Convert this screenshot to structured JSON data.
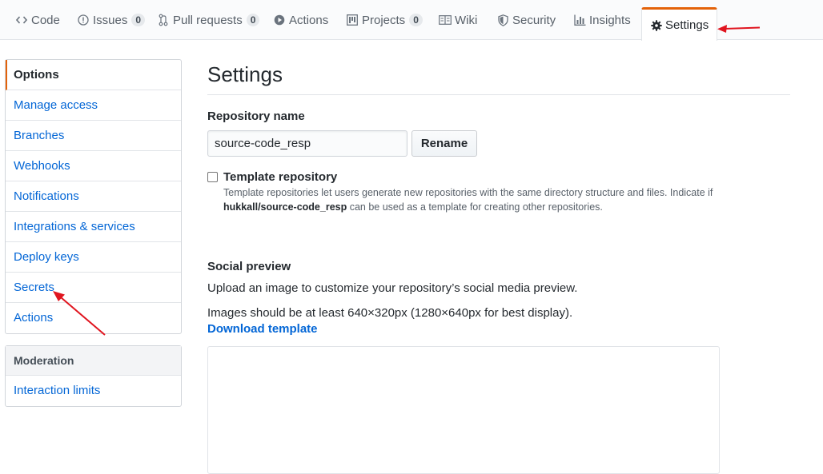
{
  "tabs": [
    {
      "label": "Code",
      "icon": "code-icon"
    },
    {
      "label": "Issues",
      "icon": "issue-icon",
      "count": "0"
    },
    {
      "label": "Pull requests",
      "icon": "pull-request-icon",
      "count": "0"
    },
    {
      "label": "Actions",
      "icon": "play-icon"
    },
    {
      "label": "Projects",
      "icon": "project-icon",
      "count": "0"
    },
    {
      "label": "Wiki",
      "icon": "book-icon"
    },
    {
      "label": "Security",
      "icon": "shield-icon"
    },
    {
      "label": "Insights",
      "icon": "graph-icon"
    },
    {
      "label": "Settings",
      "icon": "gear-icon",
      "selected": true
    }
  ],
  "sidebar": {
    "items": [
      {
        "label": "Options",
        "selected": true
      },
      {
        "label": "Manage access"
      },
      {
        "label": "Branches"
      },
      {
        "label": "Webhooks"
      },
      {
        "label": "Notifications"
      },
      {
        "label": "Integrations & services"
      },
      {
        "label": "Deploy keys"
      },
      {
        "label": "Secrets"
      },
      {
        "label": "Actions"
      }
    ],
    "moderation": {
      "heading": "Moderation",
      "items": [
        {
          "label": "Interaction limits"
        }
      ]
    }
  },
  "main": {
    "title": "Settings",
    "repo_name_label": "Repository name",
    "repo_name_value": "source-code_resp",
    "rename_label": "Rename",
    "template": {
      "label": "Template repository",
      "note_prefix": "Template repositories let users generate new repositories with the same directory structure and files. Indicate if",
      "note_repo": "hukkall/source-code_resp",
      "note_suffix": "can be used as a template for creating other repositories."
    },
    "social": {
      "heading": "Social preview",
      "description": "Upload an image to customize your repository’s social media preview.",
      "size_hint": "Images should be at least 640×320px (1280×640px for best display).",
      "download_link": "Download template"
    }
  },
  "colors": {
    "accent": "#e36209",
    "link": "#0366d6",
    "annotation_arrow": "#e0151f"
  }
}
